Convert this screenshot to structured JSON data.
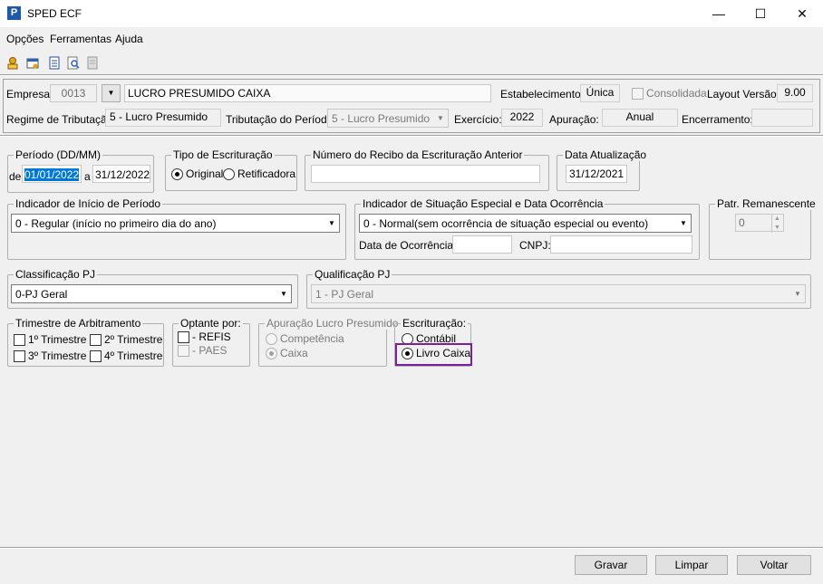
{
  "window": {
    "title": "SPED ECF",
    "app_icon": "P"
  },
  "menu": [
    "Opções",
    "Ferramentas",
    "Ajuda"
  ],
  "toolbar": [
    "open-icon",
    "settings-icon",
    "document-icon",
    "search-document-icon",
    "report-icon"
  ],
  "header": {
    "empresa_label": "Empresa:",
    "empresa_code": "0013",
    "empresa_name": "LUCRO PRESUMIDO CAIXA",
    "estabelecimento_label": "Estabelecimento:",
    "estabelecimento_value": "Única",
    "consolidada_label": "Consolidada",
    "layout_label": "Layout Versão:",
    "layout_value": "9.00",
    "regime_label": "Regime de Tributação:",
    "regime_value": "5 - Lucro Presumido",
    "tributacao_label": "Tributação do Período:",
    "tributacao_value": "5 - Lucro Presumido",
    "exercicio_label": "Exercício:",
    "exercicio_value": "2022",
    "apuracao_label": "Apuração:",
    "apuracao_value": "Anual",
    "encerramento_label": "Encerramento:",
    "encerramento_value": ""
  },
  "periodo": {
    "legend": "Período (DD/MM)",
    "de_label": "de",
    "from": "01/01/2022",
    "a_label": "a",
    "to": "31/12/2022"
  },
  "tipo": {
    "legend": "Tipo de Escrituração",
    "original": "Original",
    "retificadora": "Retificadora"
  },
  "recibo": {
    "legend": "Número do Recibo da Escrituração Anterior",
    "value": ""
  },
  "data_atualizacao": {
    "legend": "Data Atualização",
    "value": "31/12/2021"
  },
  "indicador_inicio": {
    "legend": "Indicador de Início de Período",
    "value": "0 - Regular (início no primeiro dia do ano)"
  },
  "indicador_situacao": {
    "legend": "Indicador de Situação Especial e Data Ocorrência",
    "value": "0 - Normal(sem ocorrência de situação especial ou evento)",
    "data_label": "Data de Ocorrência:",
    "cnpj_label": "CNPJ:"
  },
  "patr": {
    "legend": "Patr. Remanescente",
    "value": "0"
  },
  "classificacao": {
    "legend": "Classificação PJ",
    "value": "0-PJ Geral"
  },
  "qualificacao": {
    "legend": "Qualificação PJ",
    "value": "1 - PJ Geral"
  },
  "trimestre": {
    "legend": "Trimestre de Arbitramento",
    "t1": "1º Trimestre",
    "t2": "2º Trimestre",
    "t3": "3º Trimestre",
    "t4": "4º Trimestre"
  },
  "optante": {
    "legend": "Optante por:",
    "refis": "- REFIS",
    "paes": "- PAES"
  },
  "apuracao_lp": {
    "legend": "Apuração Lucro Presumido",
    "competencia": "Competência",
    "caixa": "Caixa"
  },
  "escrituracao": {
    "legend": "Escrituração:",
    "contabil": "Contábil",
    "livro_caixa": "Livro Caixa"
  },
  "buttons": {
    "gravar": "Gravar",
    "limpar": "Limpar",
    "voltar": "Voltar"
  },
  "colors": {
    "highlight": "#7b1fa2",
    "selection": "#0078d7"
  }
}
